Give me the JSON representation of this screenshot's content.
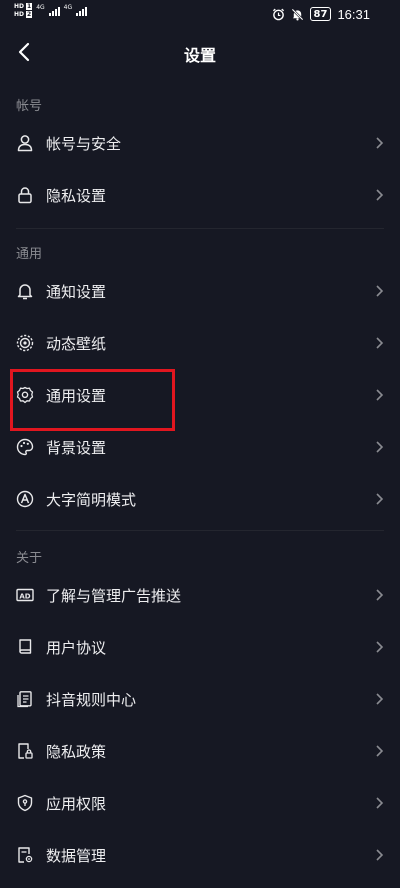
{
  "status_bar": {
    "hd1": "HD",
    "hd1_num": "1",
    "hd2": "HD",
    "hd2_num": "2",
    "net1": "4G",
    "net2": "4G",
    "battery": "87",
    "time": "16:31",
    "icons": [
      "alarm-icon",
      "mute-icon"
    ]
  },
  "header": {
    "title": "设置"
  },
  "sections": [
    {
      "label": "帐号",
      "items": [
        {
          "label": "帐号与安全",
          "icon": "person-icon"
        },
        {
          "label": "隐私设置",
          "icon": "lock-icon"
        }
      ]
    },
    {
      "label": "通用",
      "items": [
        {
          "label": "通知设置",
          "icon": "bell-icon"
        },
        {
          "label": "动态壁纸",
          "icon": "wallpaper-icon"
        },
        {
          "label": "通用设置",
          "icon": "gear-icon"
        },
        {
          "label": "背景设置",
          "icon": "palette-icon"
        },
        {
          "label": "大字简明模式",
          "icon": "font-size-icon"
        }
      ]
    },
    {
      "label": "关于",
      "items": [
        {
          "label": "了解与管理广告推送",
          "icon": "ad-icon"
        },
        {
          "label": "用户协议",
          "icon": "book-icon"
        },
        {
          "label": "抖音规则中心",
          "icon": "rules-icon"
        },
        {
          "label": "隐私政策",
          "icon": "privacy-doc-icon"
        },
        {
          "label": "应用权限",
          "icon": "shield-icon"
        },
        {
          "label": "数据管理",
          "icon": "data-manage-icon"
        }
      ]
    }
  ],
  "colors": {
    "background": "#161823",
    "highlight": "#e1161f",
    "section_label": "#8a8b91"
  }
}
